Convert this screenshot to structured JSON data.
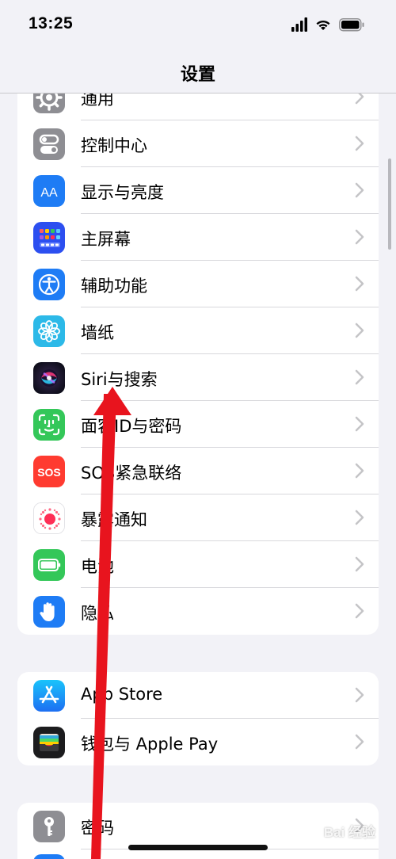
{
  "status_bar": {
    "time": "13:25"
  },
  "nav": {
    "title": "设置"
  },
  "groups": [
    {
      "items": [
        {
          "label": "通用",
          "icon": "gear-icon",
          "color": "#8e8e93"
        },
        {
          "label": "控制中心",
          "icon": "toggles-icon",
          "color": "#8e8e93"
        },
        {
          "label": "显示与亮度",
          "icon": "display-brightness-icon",
          "color": "#1e7cf5",
          "glyph": "AA"
        },
        {
          "label": "主屏幕",
          "icon": "home-screen-grid-icon",
          "color": "#2c4ff0"
        },
        {
          "label": "辅助功能",
          "icon": "accessibility-icon",
          "color": "#1e7cf5"
        },
        {
          "label": "墙纸",
          "icon": "wallpaper-flower-icon",
          "color": "#2cb9e8"
        },
        {
          "label": "Siri与搜索",
          "icon": "siri-icon",
          "color": "#1a1a2e"
        },
        {
          "label": "面容ID与密码",
          "icon": "face-id-icon",
          "color": "#34c759"
        },
        {
          "label": "SOS紧急联络",
          "icon": "sos-icon",
          "color": "#ff3b30",
          "glyph": "SOS"
        },
        {
          "label": "暴露通知",
          "icon": "exposure-notification-icon",
          "color": "#ffffff"
        },
        {
          "label": "电池",
          "icon": "battery-icon",
          "color": "#34c759"
        },
        {
          "label": "隐私",
          "icon": "privacy-hand-icon",
          "color": "#1e7cf5"
        }
      ]
    },
    {
      "items": [
        {
          "label": "App Store",
          "icon": "app-store-icon",
          "color": "#1e9bf5"
        },
        {
          "label": "钱包与 Apple Pay",
          "icon": "wallet-icon",
          "color": "#1c1c1e"
        }
      ]
    },
    {
      "items": [
        {
          "label": "密码",
          "icon": "key-icon",
          "color": "#8e8e93"
        }
      ]
    }
  ],
  "annotation": {
    "arrow_color": "#e8141e"
  },
  "watermark": {
    "text": "Bai 经验"
  }
}
